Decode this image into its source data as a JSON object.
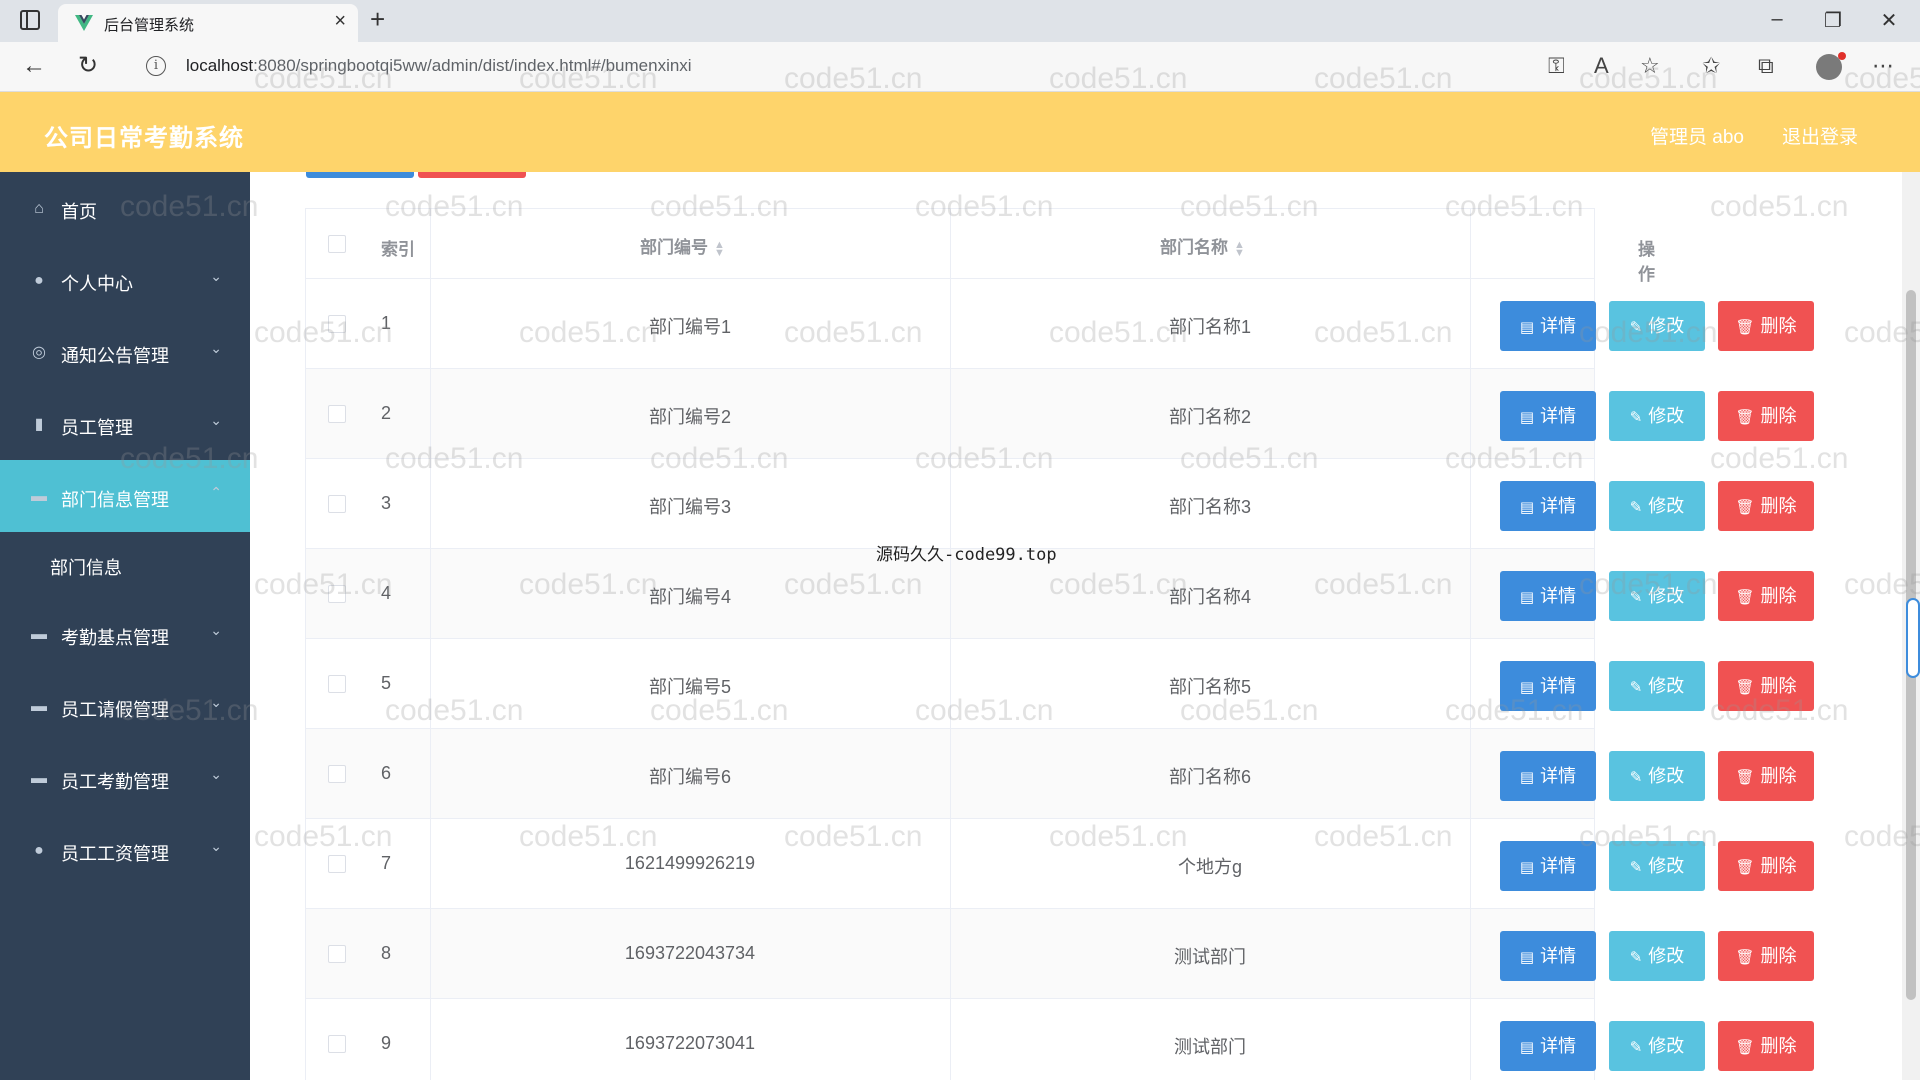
{
  "browser": {
    "tab_title": "后台管理系统",
    "url_host": "localhost",
    "url_rest": ":8080/springbootqi5ww/admin/dist/index.html#/bumenxinxi"
  },
  "header": {
    "title": "公司日常考勤系统",
    "user": "管理员 abo",
    "logout": "退出登录"
  },
  "sidebar": {
    "items": [
      {
        "label": "首页",
        "icon": "home-icon",
        "expandable": false
      },
      {
        "label": "个人中心",
        "icon": "user-icon",
        "expandable": true
      },
      {
        "label": "通知公告管理",
        "icon": "settings-icon",
        "expandable": true
      },
      {
        "label": "员工管理",
        "icon": "chart-icon",
        "expandable": true
      },
      {
        "label": "部门信息管理",
        "icon": "monitor-icon",
        "expandable": true,
        "active": true
      },
      {
        "label": "考勤基点管理",
        "icon": "chat-icon",
        "expandable": true
      },
      {
        "label": "员工请假管理",
        "icon": "monitor-icon",
        "expandable": true
      },
      {
        "label": "员工考勤管理",
        "icon": "monitor-icon",
        "expandable": true
      },
      {
        "label": "员工工资管理",
        "icon": "user-icon",
        "expandable": true
      }
    ],
    "submenu": {
      "label": "部门信息"
    }
  },
  "table": {
    "headers": {
      "index": "索引",
      "code": "部门编号",
      "name": "部门名称",
      "actions": "操作"
    },
    "buttons": {
      "detail": "详情",
      "edit": "修改",
      "delete": "删除"
    },
    "rows": [
      {
        "index": "1",
        "code": "部门编号1",
        "name": "部门名称1"
      },
      {
        "index": "2",
        "code": "部门编号2",
        "name": "部门名称2"
      },
      {
        "index": "3",
        "code": "部门编号3",
        "name": "部门名称3"
      },
      {
        "index": "4",
        "code": "部门编号4",
        "name": "部门名称4"
      },
      {
        "index": "5",
        "code": "部门编号5",
        "name": "部门名称5"
      },
      {
        "index": "6",
        "code": "部门编号6",
        "name": "部门名称6"
      },
      {
        "index": "7",
        "code": "1621499926219",
        "name": "个地方g"
      },
      {
        "index": "8",
        "code": "1693722043734",
        "name": "测试部门"
      },
      {
        "index": "9",
        "code": "1693722073041",
        "name": "测试部门"
      }
    ]
  },
  "overlay": "源码久久-code99.top",
  "watermark": "code51.cn",
  "colors": {
    "header_bg": "#fed46b",
    "sidebar_bg": "#304156",
    "active_menu": "#4fc0d3",
    "detail": "#3d8cdc",
    "edit": "#59c3e0",
    "delete": "#f05252"
  }
}
